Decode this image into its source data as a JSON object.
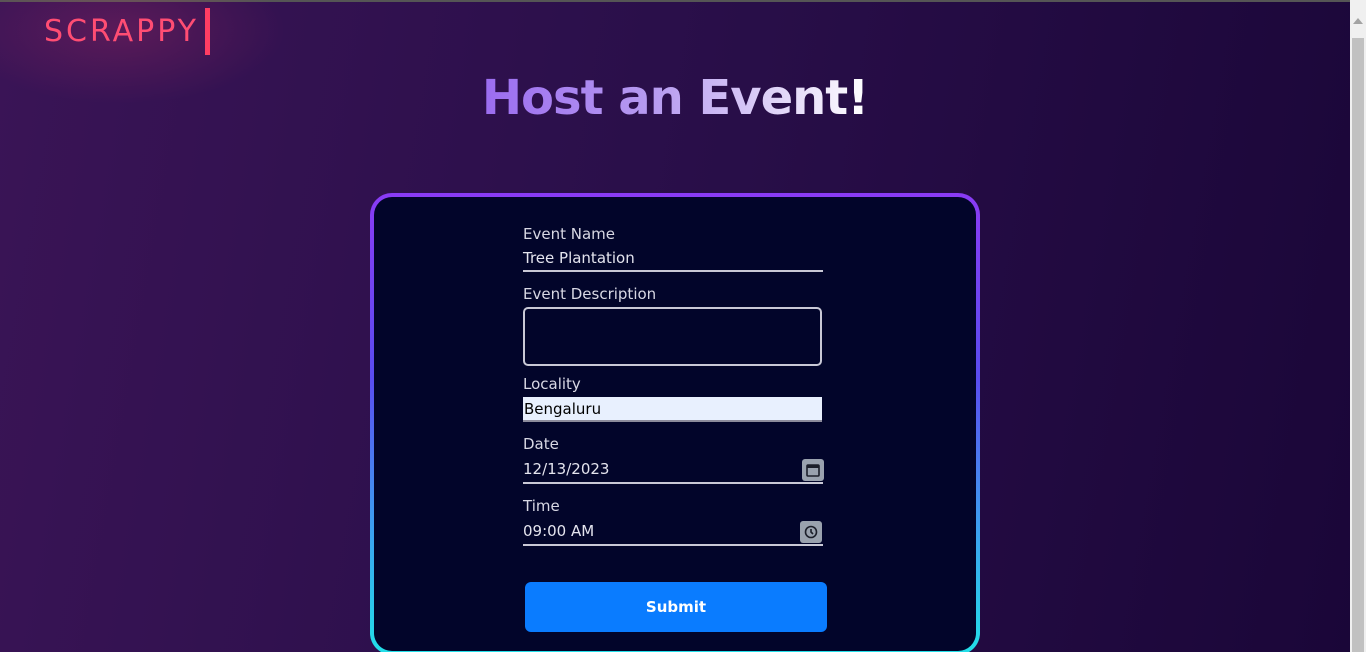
{
  "brand": {
    "logo_text": "SCRAPPY"
  },
  "page": {
    "title": "Host an Event!"
  },
  "form": {
    "event_name": {
      "label": "Event Name",
      "value": "Tree Plantation"
    },
    "event_description": {
      "label": "Event Description",
      "value": ""
    },
    "locality": {
      "label": "Locality",
      "value": "Bengaluru"
    },
    "date": {
      "label": "Date",
      "value": "12/13/2023"
    },
    "time": {
      "label": "Time",
      "value": "09:00 AM"
    },
    "submit_label": "Submit"
  },
  "colors": {
    "brand_pink": "#ff4d73",
    "submit_blue": "#0a7cff",
    "card_bg": "#02052a",
    "border_gradient_top": "#8a3bf5",
    "border_gradient_bottom": "#22e0e8"
  }
}
